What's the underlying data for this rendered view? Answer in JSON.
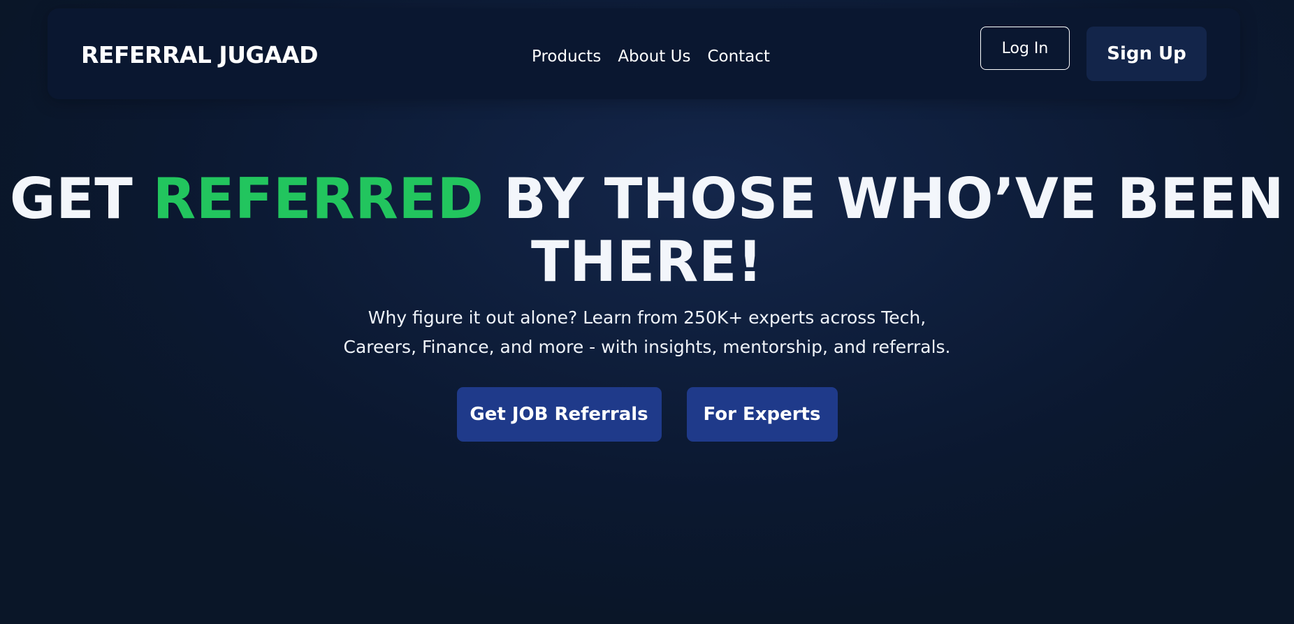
{
  "navbar": {
    "brand": "REFERRAL JUGAAD",
    "links": [
      "Products",
      "About Us",
      "Contact"
    ],
    "login_label": "Log In",
    "signup_label": "Sign Up"
  },
  "hero": {
    "headline_part1": "GET ",
    "headline_accent": "REFERRED",
    "headline_part2": " BY THOSE WHO’VE BEEN THERE!",
    "subtitle": "Why figure it out alone? Learn from 250K+ experts across Tech, Careers, Finance, and more - with insights, mentorship, and referrals.",
    "cta_primary": "Get JOB Referrals",
    "cta_secondary": "For Experts"
  },
  "colors": {
    "accent_green": "#22c55e",
    "button_blue": "#1f3a8a",
    "navbar_bg": "#0a1730",
    "page_bg": "#0c1a33"
  }
}
